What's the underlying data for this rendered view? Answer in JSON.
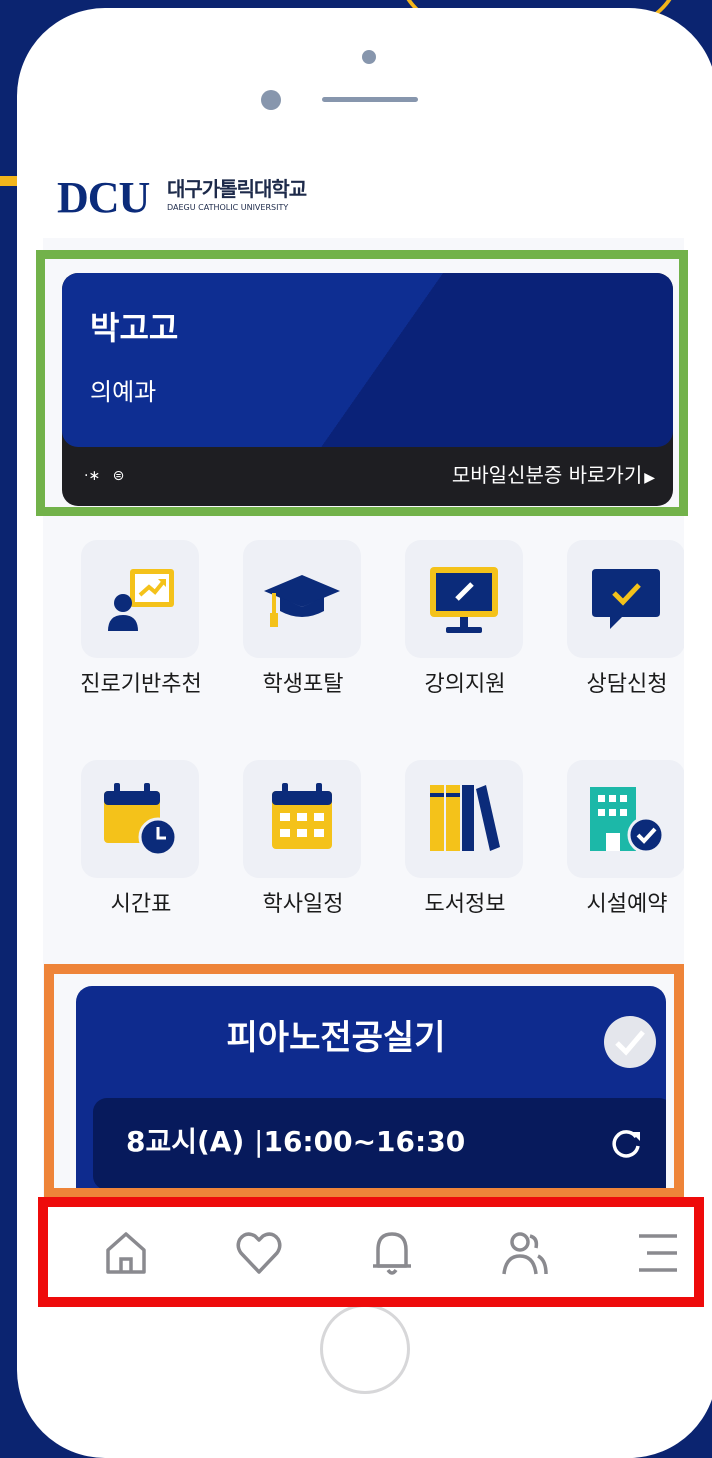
{
  "header": {
    "logo_mark": "DCU",
    "logo_korean": "대구가톨릭대학교",
    "logo_english": "DAEGU CATHOLIC UNIVERSITY"
  },
  "id_card": {
    "name": "박고고",
    "department": "의예과",
    "link_label": "모바일신분증 바로가기",
    "link_arrow": "▶",
    "bluetooth_glyph": "·∗",
    "nfc_glyph": "⊜",
    "colors": {
      "card_blue": "#0e2e92",
      "card_dark": "#1e1e22"
    }
  },
  "menu": [
    {
      "label": "진로기반추천",
      "icon": "career-presentation-icon"
    },
    {
      "label": "학생포탈",
      "icon": "graduation-cap-icon"
    },
    {
      "label": "강의지원",
      "icon": "monitor-pencil-icon"
    },
    {
      "label": "상담신청",
      "icon": "chat-check-icon"
    },
    {
      "label": "시간표",
      "icon": "calendar-clock-icon"
    },
    {
      "label": "학사일정",
      "icon": "calendar-grid-icon"
    },
    {
      "label": "도서정보",
      "icon": "books-icon"
    },
    {
      "label": "시설예약",
      "icon": "building-check-icon"
    }
  ],
  "lesson_card": {
    "title": "피아노전공실기",
    "period": "8교시(A)",
    "divider": "|",
    "time": "16:00~16:30",
    "check_icon": "check-circle-icon",
    "refresh_icon": "refresh-icon"
  },
  "bottom_nav": [
    {
      "icon": "home-icon"
    },
    {
      "icon": "heart-icon"
    },
    {
      "icon": "bell-icon"
    },
    {
      "icon": "users-icon"
    },
    {
      "icon": "menu-icon"
    }
  ],
  "theme": {
    "background": "#0b2470",
    "accent_yellow": "#f2b51b",
    "brand_navy": "#0b2b7a",
    "highlight_green": "#72b24a",
    "highlight_orange": "#ee8439",
    "highlight_red": "#ee0b0b"
  }
}
